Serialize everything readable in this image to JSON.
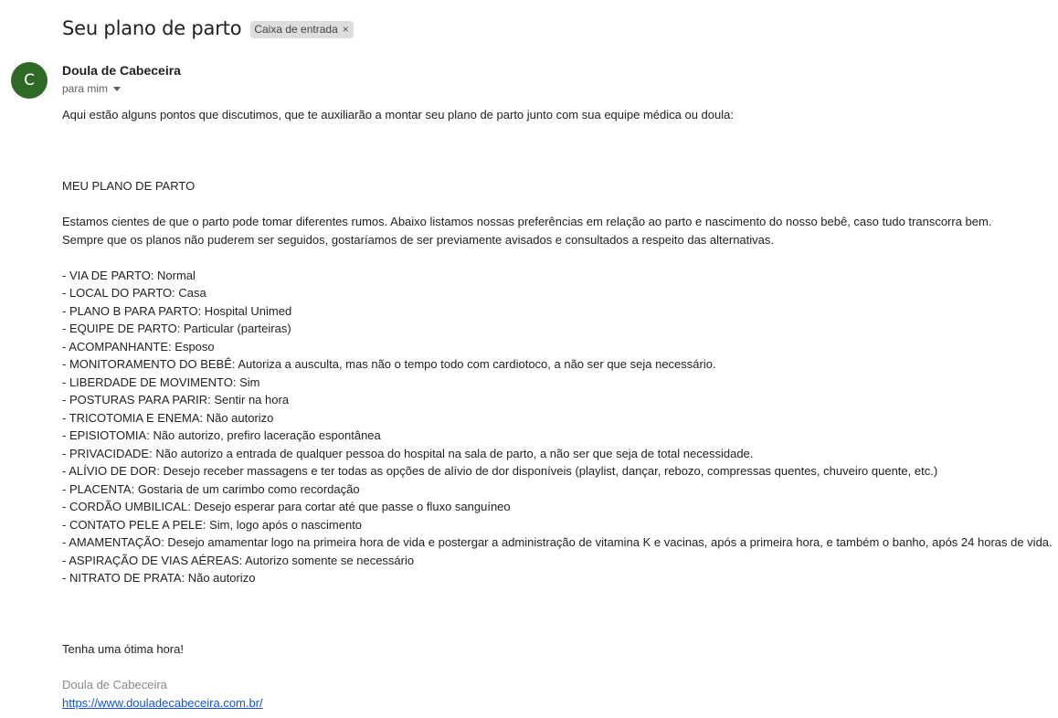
{
  "email": {
    "subject": "Seu plano de parto",
    "label_chip": "Caixa de entrada",
    "label_remove_glyph": "×",
    "sender": {
      "avatar_initial": "C",
      "avatar_color": "#2e6a25",
      "name": "Doula de Cabeceira",
      "recipient_text": "para mim"
    },
    "body": {
      "intro": "Aqui estão alguns pontos que discutimos, que te auxiliarão a montar seu plano de parto junto com sua equipe médica ou doula:",
      "heading": "MEU PLANO DE PARTO",
      "paragraph_line_1": "Estamos cientes de que o parto pode tomar diferentes rumos. Abaixo listamos nossas preferências em relação ao parto e nascimento do nosso bebê, caso tudo transcorra bem.",
      "paragraph_line_2": "Sempre que os planos não puderem ser seguidos, gostaríamos de ser previamente avisados e consultados a respeito das alternativas.",
      "items": [
        "- VIA DE PARTO: Normal",
        "- LOCAL DO PARTO: Casa",
        "- PLANO B PARA PARTO: Hospital Unimed",
        "- EQUIPE DE PARTO: Particular (parteiras)",
        "- ACOMPANHANTE: Esposo",
        "- MONITORAMENTO DO BEBÊ: Autoriza a ausculta, mas não o tempo todo com cardiotoco, a não ser que seja necessário.",
        "- LIBERDADE DE MOVIMENTO: Sim",
        "- POSTURAS PARA PARIR: Sentir na hora",
        "- TRICOTOMIA E ENEMA: Não autorizo",
        "- EPISIOTOMIA: Não autorizo, prefiro laceração espontânea",
        "- PRIVACIDADE: Não autorizo a entrada de qualquer pessoa do hospital na sala de parto, a não ser que seja de total necessidade.",
        "- ALÍVIO DE DOR: Desejo receber massagens e ter todas as opções de alívio de dor disponíveis (playlist, dançar, rebozo, compressas quentes, chuveiro quente, etc.)",
        "- PLACENTA: Gostaria de um carimbo como recordação",
        "- CORDÃO UMBILICAL: Desejo esperar para cortar até que passe o fluxo sanguíneo",
        "- CONTATO PELE A PELE: Sim, logo após o nascimento",
        "- AMAMENTAÇÃO: Desejo amamentar logo na primeira hora de vida e postergar a administração de vitamina K e vacinas, após a primeira hora, e também o banho, após 24 horas de vida.",
        "- ASPIRAÇÃO DE VIAS AÉREAS: Autorizo somente se necessário",
        "- NITRATO DE PRATA: Não autorizo"
      ],
      "closing": "Tenha uma ótima hora!",
      "signature_name": "Doula de Cabeceira",
      "signature_link": "https://www.douladecabeceira.com.br/"
    }
  }
}
